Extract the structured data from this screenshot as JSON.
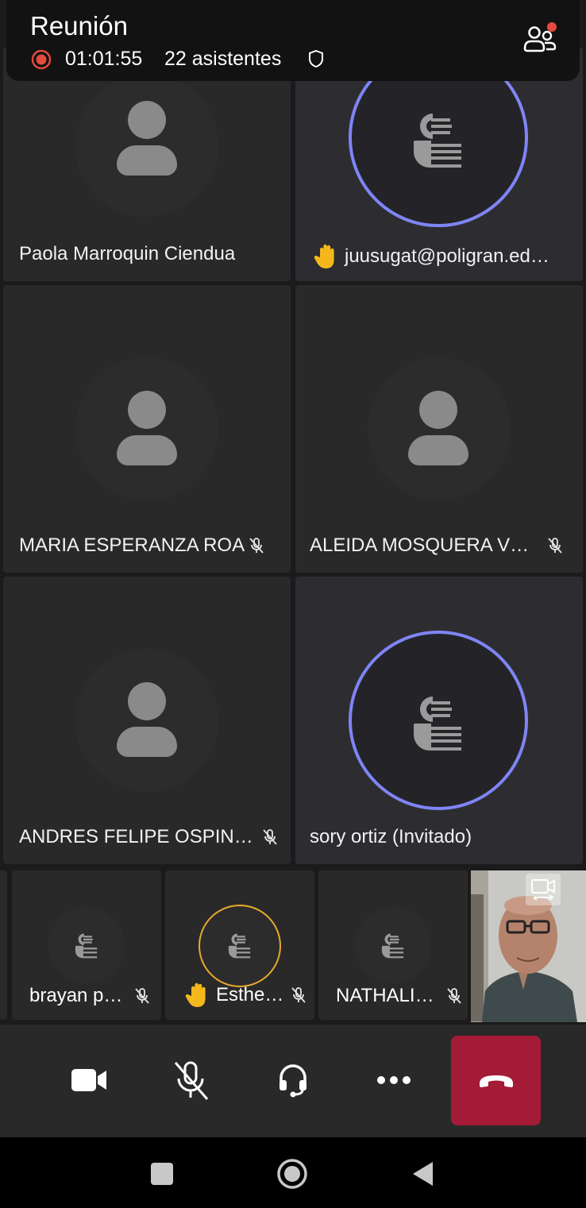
{
  "header": {
    "title": "Reunión",
    "timer": "01:01:55",
    "attendees": "22 asistentes"
  },
  "tiles": [
    {
      "name": "Paola Marroquin Ciendua"
    },
    {
      "name": "juusugat@poligran.ed…"
    },
    {
      "name": "MARIA ESPERANZA ROA"
    },
    {
      "name": "ALEIDA  MOSQUERA V…"
    },
    {
      "name": "ANDRES FELIPE OSPIN…"
    },
    {
      "name": "sory ortiz (Invitado)"
    }
  ],
  "strip": [
    {
      "name": "brayan p…"
    },
    {
      "name": "Esthe…"
    },
    {
      "name": "NATHALI…"
    }
  ],
  "colors": {
    "accent_ring": "#7f85f5",
    "raised_hand_ring": "#e8a92c",
    "recording": "#e44a3d",
    "hangup": "#a31b36"
  },
  "icons": {
    "controls": [
      "video-camera-icon",
      "microphone-off-icon",
      "headset-icon",
      "more-options-icon",
      "hang-up-icon"
    ],
    "nav": [
      "recents-icon",
      "home-icon",
      "back-icon"
    ]
  }
}
